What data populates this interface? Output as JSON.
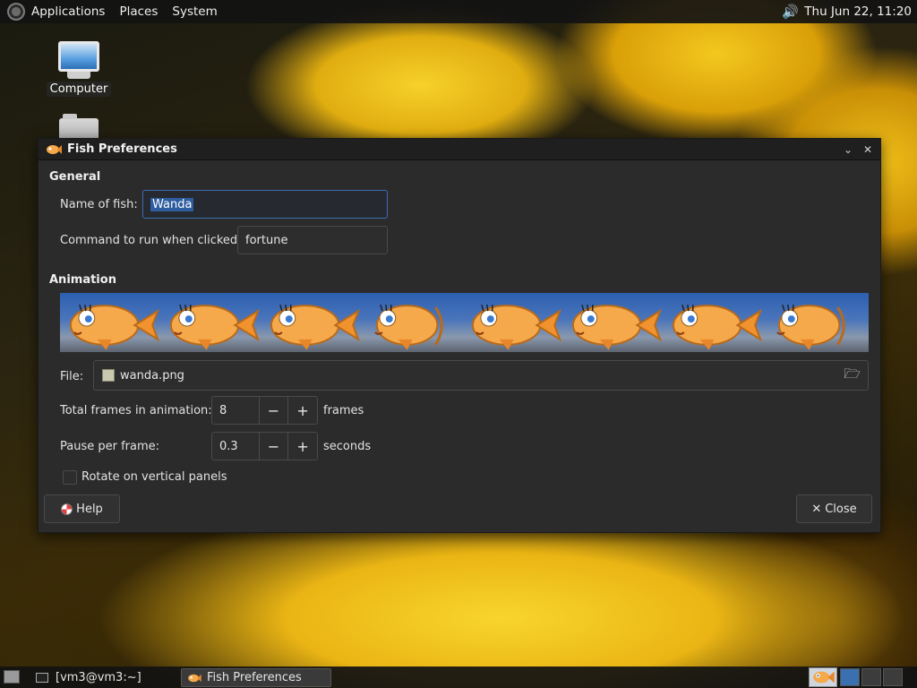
{
  "top_panel": {
    "menus": [
      "Applications",
      "Places",
      "System"
    ],
    "clock": "Thu Jun 22, 11:20"
  },
  "desktop": {
    "icons": [
      {
        "label": "Computer"
      }
    ]
  },
  "dialog": {
    "title": "Fish Preferences",
    "general": {
      "heading": "General",
      "name_label": "Name of fish:",
      "name_value": "Wanda",
      "command_label": "Command to run when clicked:",
      "command_value": "fortune"
    },
    "animation": {
      "heading": "Animation",
      "frame_count": 8,
      "file_label": "File:",
      "file_value": "wanda.png",
      "frames_label": "Total frames in animation:",
      "frames_value": "8",
      "frames_unit": "frames",
      "pause_label": "Pause per frame:",
      "pause_value": "0.3",
      "pause_unit": "seconds",
      "rotate_label": "Rotate on vertical panels",
      "rotate_checked": false
    },
    "help_label": "Help",
    "close_label": "Close",
    "minus": "−",
    "plus": "+"
  },
  "bottom_panel": {
    "tasks": [
      "[vm3@vm3:~]",
      "Fish Preferences"
    ]
  },
  "colors": {
    "accent": "#3b6db0",
    "fish": "#f5a94a"
  }
}
